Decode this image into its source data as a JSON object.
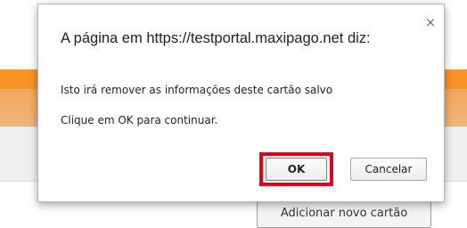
{
  "background": {
    "add_card_button_label": "Adicionar novo cartão"
  },
  "dialog": {
    "title": "A página em https://testportal.maxipago.net diz:",
    "close_label": "×",
    "message_line1": "Isto irá remover as informações deste cartão salvo",
    "message_line2": "Clique em OK para continuar.",
    "ok_label": "OK",
    "cancel_label": "Cancelar"
  },
  "colors": {
    "highlight_border": "#e3001b",
    "brand_orange": "#f79428"
  }
}
